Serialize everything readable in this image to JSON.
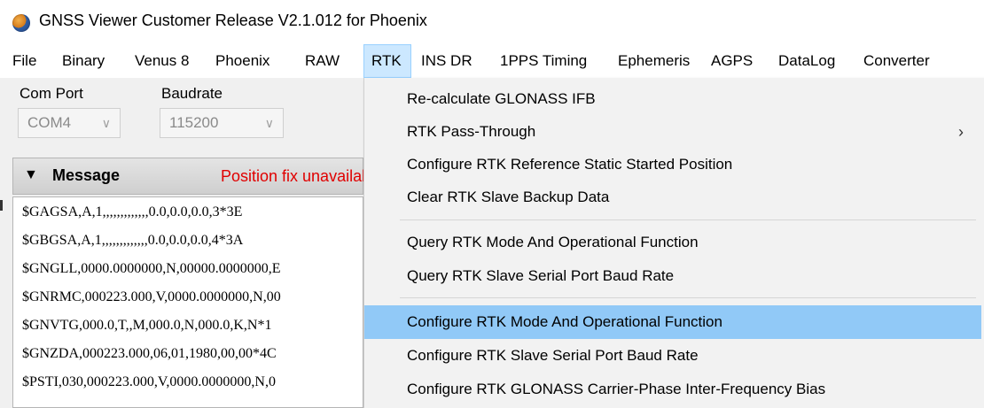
{
  "window": {
    "title": "GNSS Viewer Customer Release V2.1.012 for Phoenix",
    "icon": "globe-icon"
  },
  "menubar": {
    "items": [
      "File",
      "Binary",
      "Venus 8",
      "Phoenix",
      "RAW",
      "RTK",
      "INS DR",
      "1PPS Timing",
      "Ephemeris",
      "AGPS",
      "DataLog",
      "Converter"
    ],
    "active": "RTK"
  },
  "connection": {
    "com_port_label": "Com Port",
    "com_port_value": "COM4",
    "baudrate_label": "Baudrate",
    "baudrate_value": "115200"
  },
  "message_panel": {
    "title": "Message",
    "status": "Position fix unavailable",
    "lines": [
      "$GAGSA,A,1,,,,,,,,,,,,,0.0,0.0,0.0,3*3E",
      "$GBGSA,A,1,,,,,,,,,,,,,0.0,0.0,0.0,4*3A",
      "$GNGLL,0000.0000000,N,00000.0000000,E",
      "$GNRMC,000223.000,V,0000.0000000,N,00",
      "$GNVTG,000.0,T,,M,000.0,N,000.0,K,N*1",
      "$GNZDA,000223.000,06,01,1980,00,00*4C",
      "$PSTI,030,000223.000,V,0000.0000000,N,0"
    ]
  },
  "rtk_menu": {
    "items": [
      {
        "label": "Re-calculate GLONASS IFB",
        "submenu": false
      },
      {
        "label": "RTK Pass-Through",
        "submenu": true,
        "arrow": "›"
      },
      {
        "label": "Configure RTK Reference Static Started Position",
        "submenu": false
      },
      {
        "label": "Clear RTK Slave Backup Data",
        "submenu": false
      },
      {
        "label": "Query RTK Mode And Operational Function",
        "submenu": false
      },
      {
        "label": "Query RTK Slave Serial Port Baud Rate",
        "submenu": false
      },
      {
        "label": "Configure RTK Mode And Operational Function",
        "submenu": false,
        "highlighted": true
      },
      {
        "label": "Configure RTK Slave Serial Port Baud Rate",
        "submenu": false
      },
      {
        "label": "Configure RTK GLONASS Carrier-Phase Inter-Frequency Bias",
        "submenu": false
      }
    ]
  },
  "colors": {
    "menu_highlight": "#91c9f7",
    "active_menu": "#cce8ff",
    "status_red": "#e00000"
  }
}
